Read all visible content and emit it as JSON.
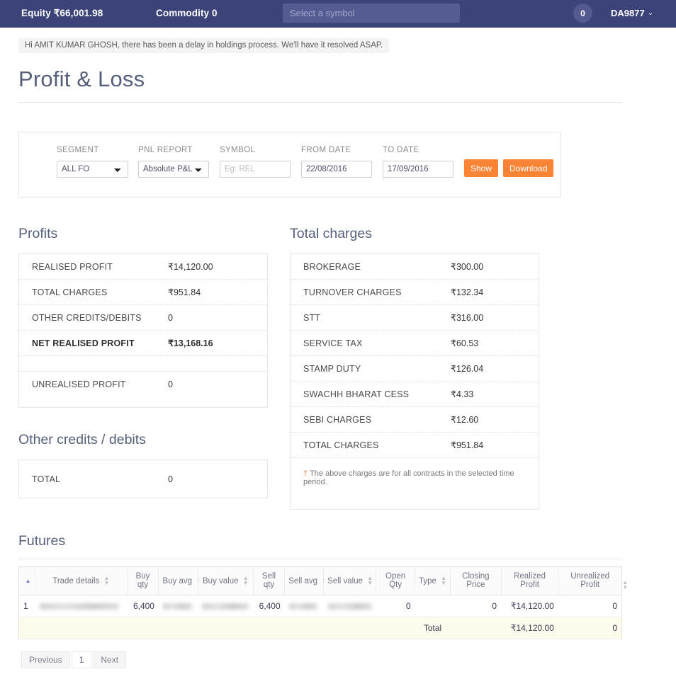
{
  "topnav": {
    "equity_label": "Equity ₹66,001.98",
    "commodity_label": "Commodity 0",
    "symbol_placeholder": "Select a symbol",
    "symbol_value": "",
    "notification_count": "0",
    "username": "DA9877",
    "chevron": "⌄"
  },
  "notice": "Hi AMIT KUMAR GHOSH, there has been a delay in holdings process. We'll have it resolved ASAP.",
  "page_title": "Profit & Loss",
  "filters": {
    "segment_label": "SEGMENT",
    "segment_value": "ALL FO",
    "pnl_report_label": "PNL REPORT",
    "pnl_report_value": "Absolute P&L",
    "symbol_label": "SYMBOL",
    "symbol_placeholder": "Eg: REL",
    "symbol_value": "",
    "from_date_label": "FROM DATE",
    "from_date_value": "22/08/2016",
    "to_date_label": "TO DATE",
    "to_date_value": "17/09/2016",
    "show_button": "Show",
    "download_button": "Download"
  },
  "profits": {
    "title": "Profits",
    "rows": [
      {
        "label": "REALISED PROFIT",
        "value": "₹14,120.00"
      },
      {
        "label": "TOTAL CHARGES",
        "value": "₹951.84"
      },
      {
        "label": "OTHER CREDITS/DEBITS",
        "value": "0"
      },
      {
        "label": "NET REALISED PROFIT",
        "value": "₹13,168.16"
      },
      {
        "label": "UNREALISED PROFIT",
        "value": "0"
      }
    ]
  },
  "other_credits": {
    "title": "Other credits / debits",
    "rows": [
      {
        "label": "TOTAL",
        "value": "0"
      }
    ]
  },
  "total_charges": {
    "title": "Total charges",
    "rows": [
      {
        "label": "BROKERAGE",
        "value": "₹300.00"
      },
      {
        "label": "TURNOVER CHARGES",
        "value": "₹132.34"
      },
      {
        "label": "STT",
        "value": "₹316.00"
      },
      {
        "label": "SERVICE TAX",
        "value": "₹60.53"
      },
      {
        "label": "STAMP DUTY",
        "value": "₹126.04"
      },
      {
        "label": "SWACHH BHARAT CESS",
        "value": "₹4.33"
      },
      {
        "label": "SEBI CHARGES",
        "value": "₹12.60"
      },
      {
        "label": "TOTAL CHARGES",
        "value": "₹951.84"
      }
    ],
    "footnote_dagger": "†",
    "footnote": "The above charges are for all contracts in the selected time period."
  },
  "futures": {
    "title": "Futures",
    "columns": [
      "",
      "Trade details",
      "Buy qty",
      "Buy avg",
      "Buy value",
      "Sell qty",
      "Sell avg",
      "Sell value",
      "Open Qty",
      "Type",
      "Closing Price",
      "Realized Profit",
      "Unrealized Profit"
    ],
    "rows": [
      {
        "index": "1",
        "trade_details": "",
        "buy_qty": "6,400",
        "buy_avg": "",
        "buy_value": "",
        "sell_qty": "6,400",
        "sell_avg": "",
        "sell_value": "",
        "open_qty": "0",
        "type": "",
        "closing_price": "0",
        "realized_profit": "₹14,120.00",
        "unrealized_profit": "0"
      }
    ],
    "total_row": {
      "label": "Total",
      "realized_profit": "₹14,120.00",
      "unrealized_profit": "0"
    }
  },
  "pagination": {
    "previous": "Previous",
    "current_page": "1",
    "next": "Next"
  },
  "colors": {
    "nav_bg": "#3b4378",
    "accent_orange": "#fb8434",
    "heading": "#555f7a",
    "total_row_bg": "#fdfcec"
  }
}
